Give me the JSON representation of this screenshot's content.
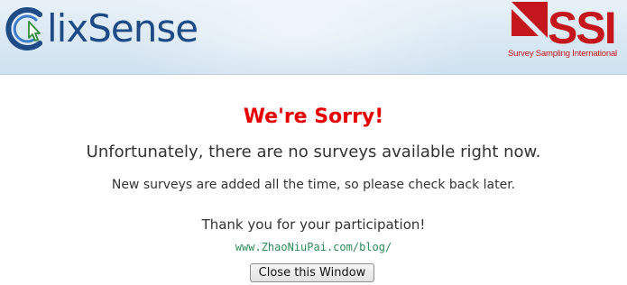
{
  "header": {
    "clixsense_logo_text": "ClixSense",
    "ssi_logo_letters": "SSI",
    "ssi_tagline": "Survey Sampling International",
    "colors": {
      "clixsense_blue": "#1e4a86",
      "ssi_red": "#c4161c"
    }
  },
  "message": {
    "title": "We're Sorry!",
    "headline": "Unfortunately, there are no surveys available right now.",
    "subtext": "New surveys are added all the time, so please check back later.",
    "thanks": "Thank you for your participation!",
    "watermark": "www.ZhaoNiuPai.com/blog/"
  },
  "actions": {
    "close_label": "Close this Window"
  },
  "colors": {
    "title_red": "#e60000",
    "body_text": "#333333",
    "watermark_green": "#2e8b57"
  }
}
